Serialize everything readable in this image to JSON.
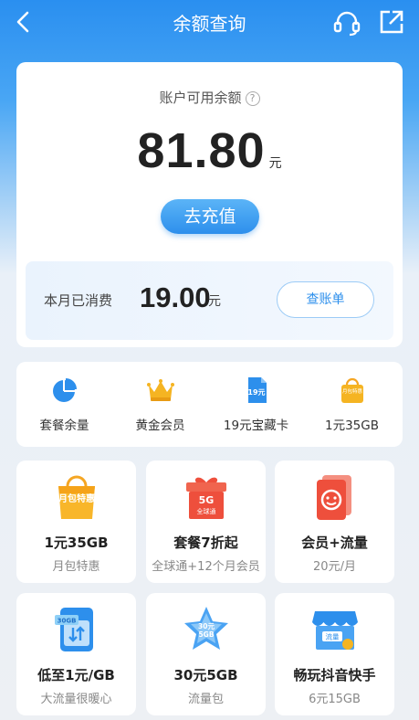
{
  "header": {
    "title": "余额查询"
  },
  "balance": {
    "label": "账户可用余额",
    "help": "?",
    "amount": "81.80",
    "unit": "元",
    "recharge_label": "去充值"
  },
  "spent": {
    "label": "本月已消费",
    "amount": "19.00",
    "unit": "元",
    "bill_label": "查账单"
  },
  "quick_links": [
    {
      "label": "套餐余量",
      "icon": "pie-chart-icon"
    },
    {
      "label": "黄金会员",
      "icon": "crown-icon"
    },
    {
      "label": "19元宝藏卡",
      "icon": "card-icon",
      "badge": "19元"
    },
    {
      "label": "1元35GB",
      "icon": "bag-icon",
      "badge": "月包特惠"
    }
  ],
  "promos": [
    {
      "title": "1元35GB",
      "sub": "月包特惠",
      "icon": "shopping-bag-icon",
      "badge": "月包特惠"
    },
    {
      "title": "套餐7折起",
      "sub": "全球通+12个月会员",
      "icon": "gift-box-icon",
      "badge": "5G",
      "badge2": "全球通"
    },
    {
      "title": "会员+流量",
      "sub": "20元/月",
      "icon": "member-cards-icon"
    },
    {
      "title": "低至1元/GB",
      "sub": "大流量很暖心",
      "icon": "data-sim-icon",
      "badge": "30GB"
    },
    {
      "title": "30元5GB",
      "sub": "流量包",
      "icon": "star-icon",
      "badge": "30元",
      "badge2": "5GB"
    },
    {
      "title": "畅玩抖音快手",
      "sub": "6元15GB",
      "icon": "shop-icon",
      "badge": "流量"
    }
  ],
  "colors": {
    "primary": "#2d8fec",
    "accent_orange": "#f5a623",
    "accent_red": "#ee4f3c"
  }
}
